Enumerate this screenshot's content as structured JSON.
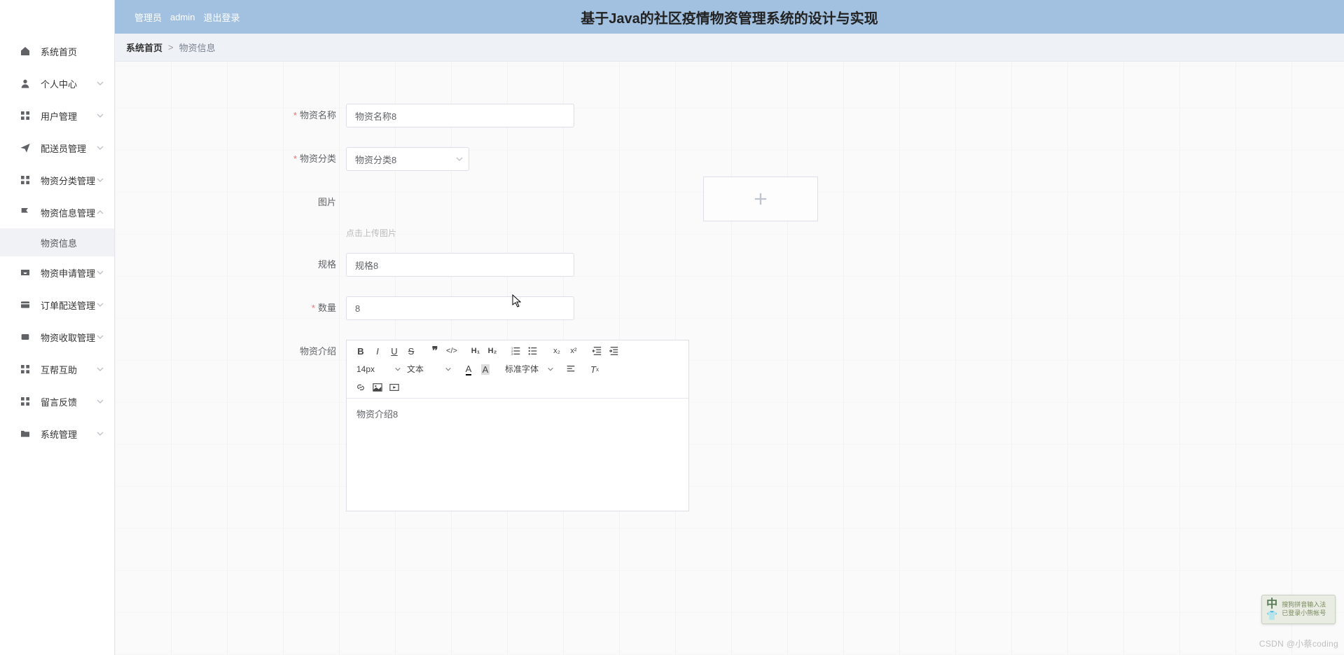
{
  "header": {
    "user_role": "管理员",
    "username": "admin",
    "logout": "退出登录",
    "title": "基于Java的社区疫情物资管理系统的设计与实现"
  },
  "breadcrumb": {
    "home": "系统首页",
    "sep": ">",
    "current": "物资信息"
  },
  "sidebar": {
    "items": [
      {
        "label": "系统首页",
        "icon": "home"
      },
      {
        "label": "个人中心",
        "icon": "user"
      },
      {
        "label": "用户管理",
        "icon": "grid"
      },
      {
        "label": "配送员管理",
        "icon": "plane"
      },
      {
        "label": "物资分类管理",
        "icon": "grid"
      },
      {
        "label": "物资信息管理",
        "icon": "flag",
        "expanded": true,
        "children": [
          {
            "label": "物资信息"
          }
        ]
      },
      {
        "label": "物资申请管理",
        "icon": "tray"
      },
      {
        "label": "订单配送管理",
        "icon": "card"
      },
      {
        "label": "物资收取管理",
        "icon": "dot"
      },
      {
        "label": "互帮互助",
        "icon": "grid"
      },
      {
        "label": "留言反馈",
        "icon": "grid"
      },
      {
        "label": "系统管理",
        "icon": "folder"
      }
    ]
  },
  "form": {
    "material_name": {
      "label": "物资名称",
      "value": "物资名称8"
    },
    "category": {
      "label": "物资分类",
      "value": "物资分类8"
    },
    "image": {
      "label": "图片",
      "tip": "点击上传图片"
    },
    "spec": {
      "label": "规格",
      "value": "规格8"
    },
    "quantity": {
      "label": "数量",
      "value": "8"
    },
    "intro": {
      "label": "物资介绍",
      "value": "物资介绍8"
    }
  },
  "editor": {
    "font_size": "14px",
    "block_type": "文本",
    "font_family": "标准字体"
  },
  "ime": {
    "mode": "中",
    "line1": "搜狗拼音输入法",
    "line2": "已登录小熊帐号"
  },
  "watermark": "CSDN @小蔡coding"
}
